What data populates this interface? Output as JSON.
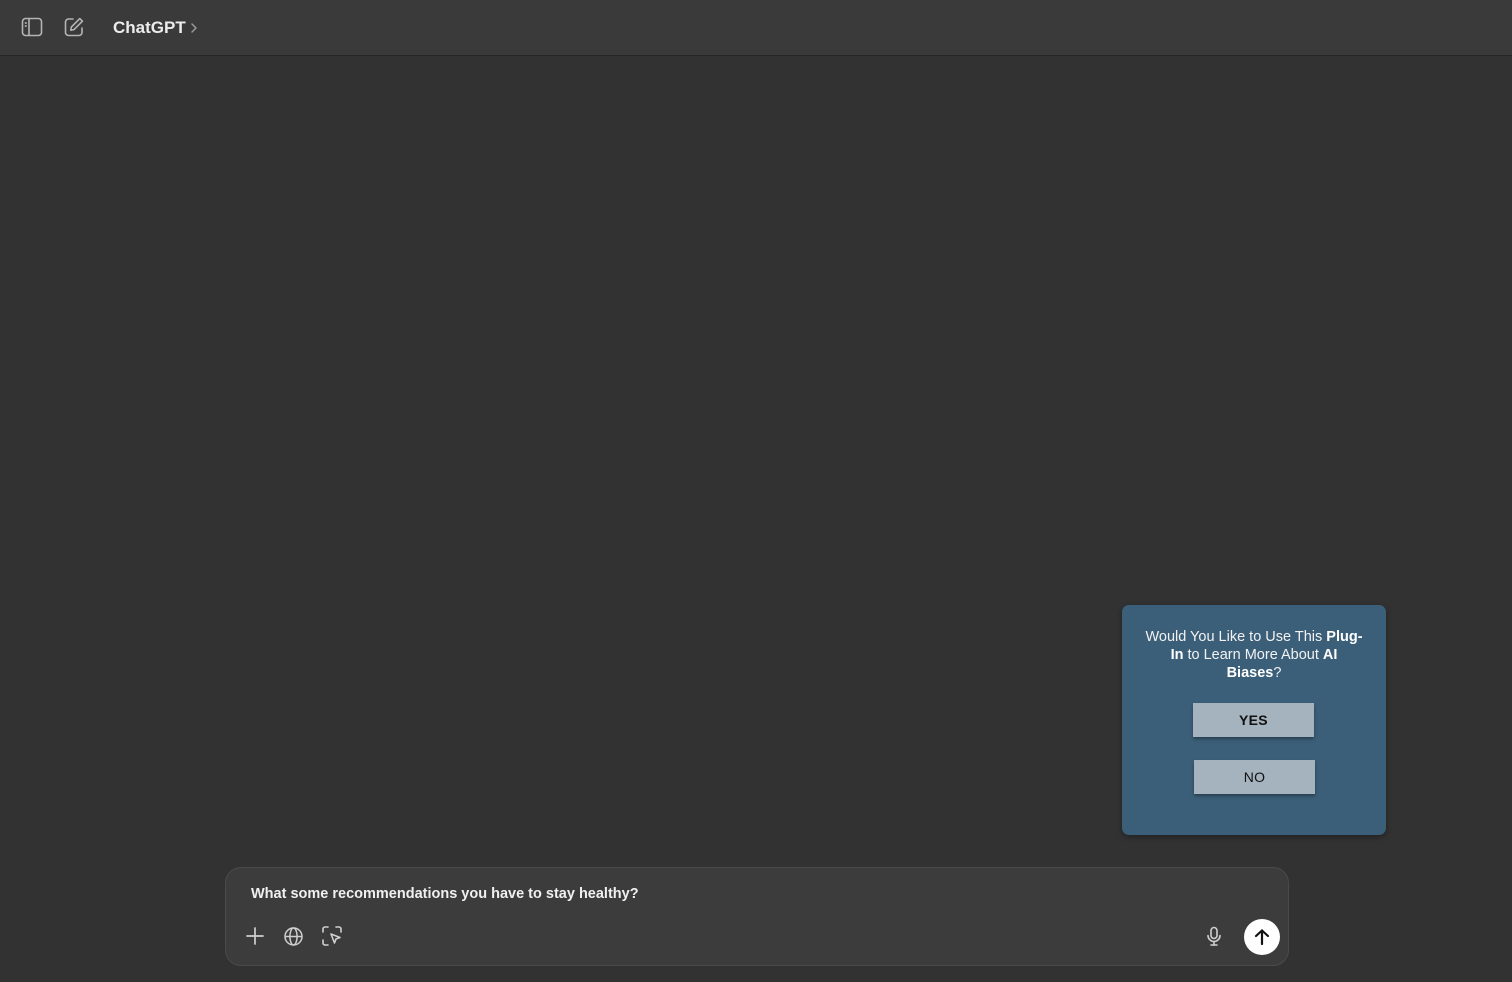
{
  "header": {
    "model_label": "ChatGPT",
    "icons": {
      "sidebar_toggle": "sidebar-toggle-icon",
      "new_chat": "new-chat-edit-icon",
      "chevron": "chevron-right-icon"
    }
  },
  "plugin_popup": {
    "question_part1": "Would You Like to Use This ",
    "question_bold1": "Plug-In",
    "question_part2": " to Learn More About ",
    "question_bold2": "AI Biases",
    "question_part3": "?",
    "yes_label": "YES",
    "no_label": "NO",
    "background_color": "#3b5f78",
    "button_color": "#a5b3be"
  },
  "composer": {
    "input_text": "What some recommendations you have to stay healthy?",
    "icons": {
      "plus": "plus-icon",
      "globe": "globe-icon",
      "select": "select-region-icon",
      "mic": "microphone-icon",
      "send": "arrow-up-icon"
    }
  },
  "theme": {
    "background": "#323232",
    "topbar": "#3a3a3a",
    "composer": "#3c3c3c"
  }
}
